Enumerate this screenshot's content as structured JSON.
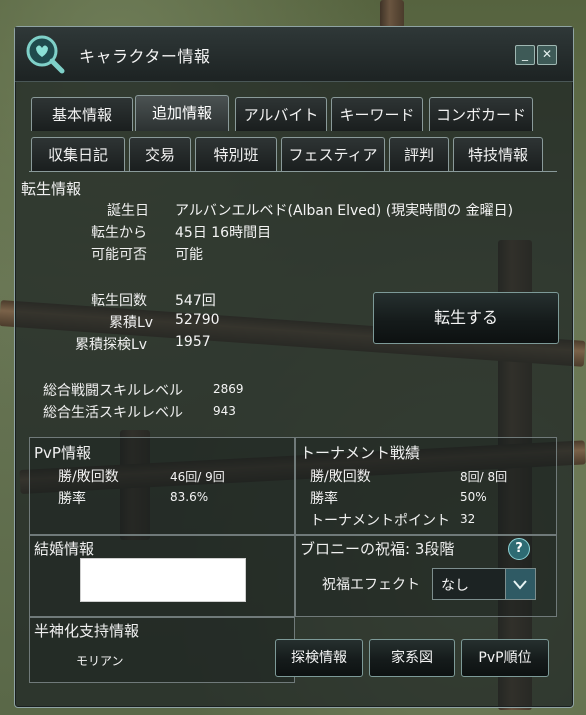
{
  "window": {
    "title": "キャラクター情報",
    "minimize": "_",
    "close": "✕"
  },
  "tabs_row1": [
    {
      "label": "基本情報"
    },
    {
      "label": "追加情報"
    },
    {
      "label": "アルバイト"
    },
    {
      "label": "キーワード"
    },
    {
      "label": "コンボカード"
    }
  ],
  "tabs_row2": [
    {
      "label": "収集日記"
    },
    {
      "label": "交易"
    },
    {
      "label": "特別班"
    },
    {
      "label": "フェスティア"
    },
    {
      "label": "評判"
    },
    {
      "label": "特技情報"
    }
  ],
  "active_tab": "追加情報",
  "rebirth": {
    "header": "転生情報",
    "birthday_label": "誕生日",
    "birthday_value": "アルバンエルベド(Alban Elved) (現実時間の 金曜日)",
    "since_label": "転生から",
    "since_value": "45日 16時間目",
    "possible_label": "可能可否",
    "possible_value": "可能",
    "count_label": "転生回数",
    "count_value": "547回",
    "cum_level_label": "累積Lv",
    "cum_level_value": "52790",
    "cum_explore_label": "累積探検Lv",
    "cum_explore_value": "1957",
    "combat_skill_label": "総合戦闘スキルレベル",
    "combat_skill_value": "2869",
    "life_skill_label": "総合生活スキルレベル",
    "life_skill_value": "943",
    "rebirth_button": "転生する"
  },
  "pvp": {
    "header": "PvP情報",
    "winloss_label": "勝/敗回数",
    "winloss_value": "46回/ 9回",
    "rate_label": "勝率",
    "rate_value": "83.6%"
  },
  "tournament": {
    "header": "トーナメント戦績",
    "winloss_label": "勝/敗回数",
    "winloss_value": "8回/ 8回",
    "rate_label": "勝率",
    "rate_value": "50%",
    "points_label": "トーナメントポイント",
    "points_value": "32"
  },
  "marriage": {
    "header": "結婚情報"
  },
  "blessing": {
    "header": "ブロニーの祝福: 3段階",
    "help": "?",
    "effect_label": "祝福エフェクト",
    "effect_value": "なし"
  },
  "demigod": {
    "header": "半神化支持情報",
    "value": "モリアン"
  },
  "bottom_buttons": {
    "explore": "探検情報",
    "family": "家系図",
    "pvp_rank": "PvP順位"
  },
  "colors": {
    "accent": "#2f5a64",
    "button_border": "#7d9a98",
    "window_bg": "rgba(28,34,34,0.72)"
  }
}
